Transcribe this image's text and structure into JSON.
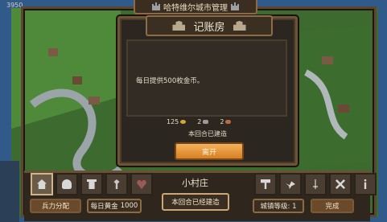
{
  "hud": {
    "coin_indicator": "3950"
  },
  "header": {
    "title": "哈特维尔城市管理",
    "icon_left": "castle-icon",
    "icon_right": "castle-icon"
  },
  "modal": {
    "title": "记账房",
    "description": "每日提供500枚金币。",
    "resources": [
      {
        "amount": "125",
        "icon": "coin-icon"
      },
      {
        "amount": "2",
        "icon": "tool-icon"
      },
      {
        "amount": "2",
        "icon": "meat-icon"
      }
    ],
    "status": "本回合已建造",
    "leave_button": "离开"
  },
  "bottom_bar": {
    "location_name": "小村庄",
    "troops_button": "兵力分配",
    "daily_gold_label": "每日黄金",
    "daily_gold_value": "1000",
    "built_status": "本回合已经建造",
    "town_level_label": "城镇等级: 1",
    "done_button": "完成"
  },
  "colors": {
    "accent_orange": "#E8952F",
    "panel": "#2C2620",
    "border": "#6E5436"
  }
}
